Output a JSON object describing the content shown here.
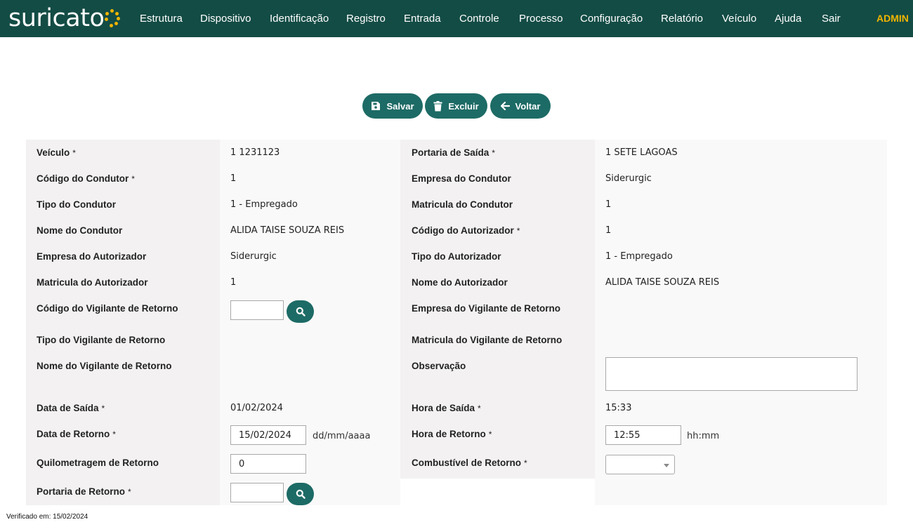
{
  "brand": {
    "name": "suricato",
    "dot_color": "#f0b400",
    "nav_bg": "#134c45"
  },
  "nav": {
    "items": [
      "Estrutura",
      "Dispositivo",
      "Identificação",
      "Registro",
      "Entrada",
      "Controle",
      "Processo",
      "Configuração",
      "Relatório",
      "Veículo",
      "Ajuda",
      "Sair"
    ],
    "user": "ADMIN"
  },
  "actions": {
    "save": "Salvar",
    "delete": "Excluir",
    "back": "Voltar",
    "button_color": "#1d6b66"
  },
  "form": {
    "required_mark": "*",
    "veiculo": {
      "label": "Veículo",
      "value": "1 1231123"
    },
    "codigo_condutor": {
      "label": "Código do Condutor",
      "value": "1"
    },
    "tipo_condutor": {
      "label": "Tipo do Condutor",
      "value": "1 - Empregado"
    },
    "nome_condutor": {
      "label": "Nome do Condutor",
      "value": "ALIDA TAISE SOUZA REIS"
    },
    "empresa_autorizador": {
      "label": "Empresa do Autorizador",
      "value": "Siderurgic"
    },
    "matricula_autorizador": {
      "label": "Matricula do Autorizador",
      "value": "1"
    },
    "codigo_vigilante": {
      "label": "Código do Vigilante de Retorno",
      "value": ""
    },
    "tipo_vigilante": {
      "label": "Tipo do Vigilante de Retorno",
      "value": ""
    },
    "nome_vigilante": {
      "label": "Nome do Vigilante de Retorno",
      "value": ""
    },
    "data_saida": {
      "label": "Data de Saída",
      "value": "01/02/2024"
    },
    "data_retorno": {
      "label": "Data de Retorno",
      "value": "15/02/2024",
      "hint": "dd/mm/aaaa"
    },
    "quilometragem": {
      "label": "Quilometragem de Retorno",
      "value": "0"
    },
    "portaria_retorno": {
      "label": "Portaria de Retorno",
      "value": ""
    },
    "portaria_saida": {
      "label": "Portaria de Saída",
      "value": "1 SETE LAGOAS"
    },
    "empresa_condutor": {
      "label": "Empresa do Condutor",
      "value": "Siderurgic"
    },
    "matricula_condutor": {
      "label": "Matricula do Condutor",
      "value": "1"
    },
    "codigo_autorizador": {
      "label": "Código do Autorizador",
      "value": "1"
    },
    "tipo_autorizador": {
      "label": "Tipo do Autorizador",
      "value": "1 - Empregado"
    },
    "nome_autorizador": {
      "label": "Nome do Autorizador",
      "value": "ALIDA TAISE SOUZA REIS"
    },
    "empresa_vigilante": {
      "label": "Empresa do Vigilante de Retorno",
      "value": ""
    },
    "matricula_vigilante": {
      "label": "Matricula do Vigilante de Retorno",
      "value": ""
    },
    "observacao": {
      "label": "Observação",
      "value": ""
    },
    "hora_saida": {
      "label": "Hora de Saída",
      "value": "15:33"
    },
    "hora_retorno": {
      "label": "Hora de Retorno",
      "value": "12:55",
      "hint": "hh:mm"
    },
    "combustivel": {
      "label": "Combustível de Retorno",
      "value": ""
    }
  },
  "footer": {
    "text": "Verificado em: 15/02/2024"
  }
}
